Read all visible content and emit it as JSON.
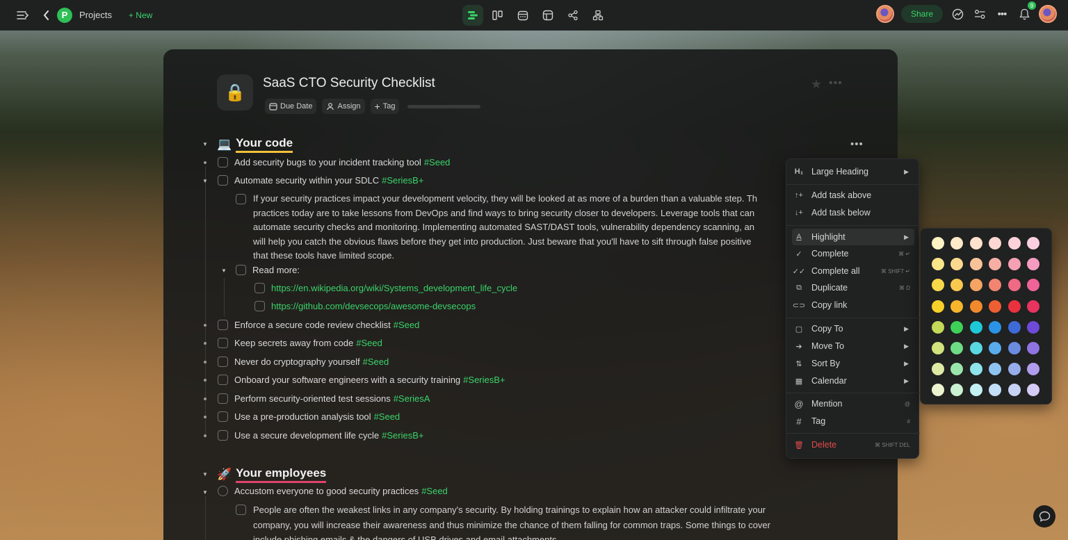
{
  "topbar": {
    "projects_label": "Projects",
    "project_initial": "P",
    "new_label": "+ New",
    "share_label": "Share",
    "notification_count": "9",
    "accent_color": "#3ad36a"
  },
  "document": {
    "icon": "🔒",
    "title": "SaaS CTO Security Checklist",
    "meta": {
      "due_date": "Due Date",
      "assign": "Assign",
      "tag": "Tag"
    }
  },
  "sections": {
    "code": {
      "emoji": "💻",
      "heading": "Your code",
      "tasks": [
        {
          "text": "Add security bugs to your incident tracking tool",
          "tag": "#Seed"
        },
        {
          "text": "Automate security within your SDLC",
          "tag": "#SeriesB+"
        },
        {
          "text": "Enforce a secure code review checklist",
          "tag": "#Seed"
        },
        {
          "text": "Keep secrets away from code",
          "tag": "#Seed"
        },
        {
          "text": "Never do cryptography yourself",
          "tag": "#Seed"
        },
        {
          "text": "Onboard your software engineers with a security training",
          "tag": "#SeriesB+"
        },
        {
          "text": "Perform security-oriented test sessions",
          "tag": "#SeriesA"
        },
        {
          "text": "Use a pre-production analysis tool",
          "tag": "#Seed"
        },
        {
          "text": "Use a secure development life cycle",
          "tag": "#SeriesB+"
        }
      ],
      "sdlc_note": [
        "If your security practices impact your development velocity, they will be looked at as more of a burden than a valuable step. Th",
        "practices today are to take lessons from DevOps and find ways to bring security closer to developers. Leverage tools that can",
        "automate security checks and monitoring. Implementing automated SAST/DAST tools, vulnerability dependency scanning, an",
        "will help you catch the obvious flaws before they get into production. Just beware that you'll have to sift through false positive",
        "that these tools have limited scope."
      ],
      "read_more": "Read more:",
      "links": [
        "https://en.wikipedia.org/wiki/Systems_development_life_cycle",
        "https://github.com/devsecops/awesome-devsecops"
      ]
    },
    "employees": {
      "emoji": "🚀",
      "heading": "Your employees",
      "tasks": [
        {
          "text": "Accustom everyone to good security practices",
          "tag": "#Seed"
        }
      ],
      "note": [
        "People are often the weakest links in any company's security. By holding trainings to explain how an attacker could infiltrate your",
        "company, you will increase their awareness and thus minimize the chance of them falling for common traps. Some things to cover",
        "include phishing emails & the dangers of USB drives and email attachments."
      ]
    }
  },
  "context_menu": {
    "large_heading": "Large Heading",
    "add_above": "Add task above",
    "add_below": "Add task below",
    "highlight": "Highlight",
    "complete": "Complete",
    "complete_sc": "⌘ ↵",
    "complete_all": "Complete all",
    "complete_all_sc": "⌘ SHIFT ↵",
    "duplicate": "Duplicate",
    "duplicate_sc": "⌘ D",
    "copy_link": "Copy link",
    "copy_to": "Copy To",
    "move_to": "Move To",
    "sort_by": "Sort By",
    "calendar": "Calendar",
    "mention": "Mention",
    "mention_sc": "@",
    "tag": "Tag",
    "tag_sc": "#",
    "delete": "Delete",
    "delete_sc": "⌘ SHIFT DEL"
  },
  "highlight_palette": [
    [
      "#fdf3c3",
      "#fde9c7",
      "#fde2cd",
      "#fcd7d3",
      "#fcd2da",
      "#fbcfe0"
    ],
    [
      "#fbe58a",
      "#fbd98e",
      "#f9c39a",
      "#f7aea4",
      "#f6a0b5",
      "#f59cc0"
    ],
    [
      "#f9d94a",
      "#f8c84f",
      "#f5a464",
      "#f28571",
      "#ef6a84",
      "#ee6398"
    ],
    [
      "#f7d02a",
      "#f6b52c",
      "#f28a2d",
      "#ee5f33",
      "#e9323e",
      "#e8345f"
    ],
    [
      "#c4d957",
      "#3dd158",
      "#1ec8d6",
      "#2a93e6",
      "#3e6ad8",
      "#6e4ad8"
    ],
    [
      "#d2e27c",
      "#6ddc84",
      "#59d9e3",
      "#59abec",
      "#6a8ce1",
      "#8f74e2"
    ],
    [
      "#deeaa3",
      "#9ae6aa",
      "#8fe4eb",
      "#8ec4f1",
      "#96aceb",
      "#b09ded"
    ],
    [
      "#ecf3cf",
      "#c9f1d2",
      "#c4f0f4",
      "#c3dff7",
      "#c6d2f4",
      "#d5ccf5"
    ]
  ]
}
